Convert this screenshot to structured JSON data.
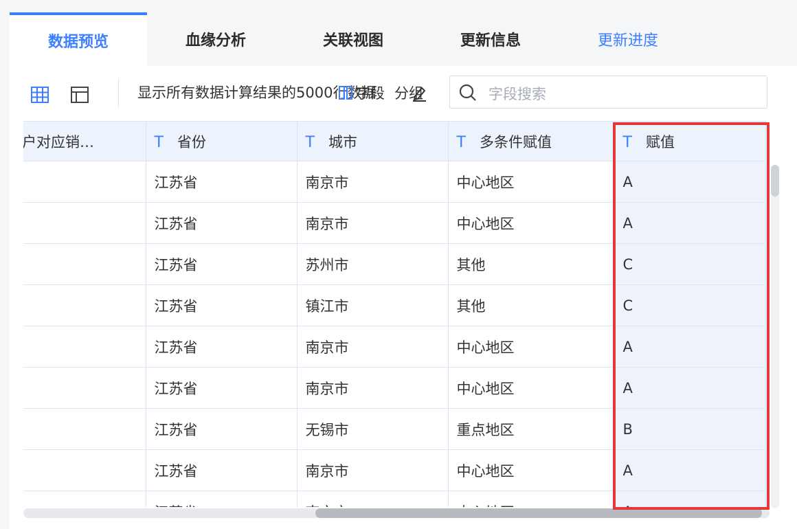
{
  "tabs": [
    {
      "label": "数据预览",
      "active": true
    },
    {
      "label": "血缘分析",
      "active": false
    },
    {
      "label": "关联视图",
      "active": false
    },
    {
      "label": "更新信息",
      "active": false
    },
    {
      "label": "更新进度",
      "active": false,
      "link": true
    }
  ],
  "toolbar": {
    "info_text": "显示所有数据计算结果的5000行数据",
    "overlay_1": "字段",
    "overlay_2": "分组",
    "search_placeholder": "字段搜索",
    "icons": [
      "grid-view-icon",
      "layout-view-icon",
      "field-icon",
      "group-edit-icon",
      "search-icon"
    ]
  },
  "table": {
    "columns": [
      {
        "label": "户对应销…",
        "type_icon": ""
      },
      {
        "label": "省份",
        "type_icon": "T"
      },
      {
        "label": "城市",
        "type_icon": "T"
      },
      {
        "label": "多条件赋值",
        "type_icon": "T"
      },
      {
        "label": "赋值",
        "type_icon": "T"
      }
    ],
    "rows": [
      [
        "",
        "江苏省",
        "南京市",
        "中心地区",
        "A"
      ],
      [
        "",
        "江苏省",
        "南京市",
        "中心地区",
        "A"
      ],
      [
        "",
        "江苏省",
        "苏州市",
        "其他",
        "C"
      ],
      [
        "",
        "江苏省",
        "镇江市",
        "其他",
        "C"
      ],
      [
        "",
        "江苏省",
        "南京市",
        "中心地区",
        "A"
      ],
      [
        "",
        "江苏省",
        "南京市",
        "中心地区",
        "A"
      ],
      [
        "",
        "江苏省",
        "无锡市",
        "重点地区",
        "B"
      ],
      [
        "",
        "江苏省",
        "南京市",
        "中心地区",
        "A"
      ],
      [
        "",
        "江苏省",
        "南京市",
        "中心地区",
        "A"
      ]
    ]
  },
  "colors": {
    "accent": "#3d7fff",
    "highlight_box": "#e5383b",
    "header_bg": "#edf3fc"
  }
}
